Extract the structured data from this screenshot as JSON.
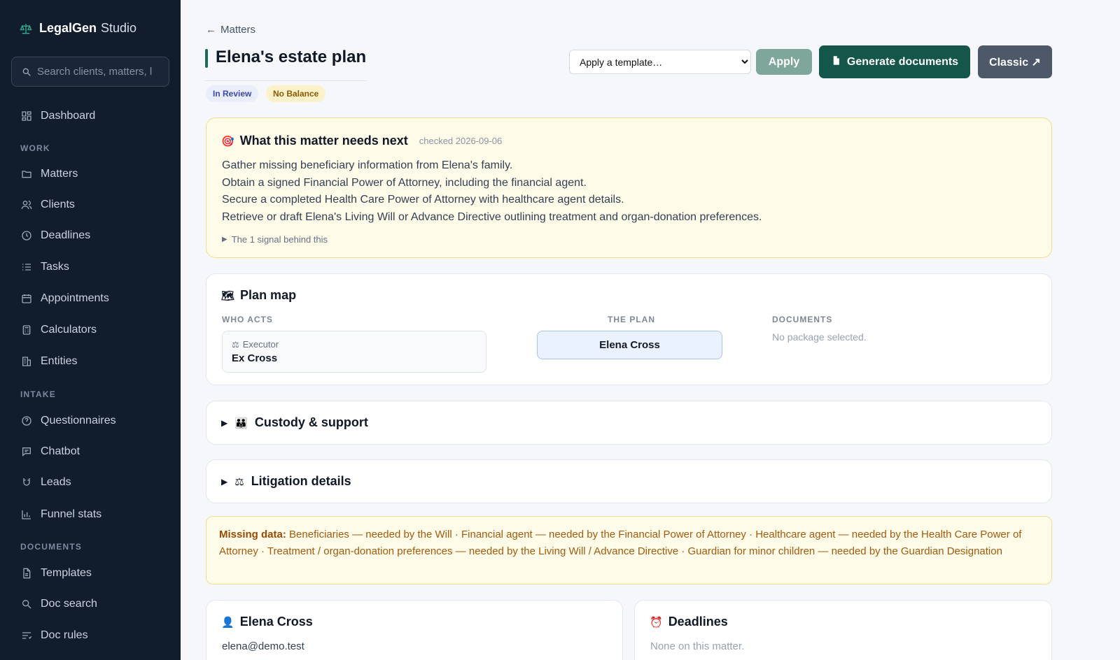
{
  "sidebar": {
    "brand_bold": "LegalGen",
    "brand_light": "Studio",
    "search_placeholder": "Search clients, matters, l",
    "dashboard": "Dashboard",
    "sections": {
      "work": "WORK",
      "intake": "INTAKE",
      "documents": "DOCUMENTS"
    },
    "work_items": [
      "Matters",
      "Clients",
      "Deadlines",
      "Tasks",
      "Appointments",
      "Calculators",
      "Entities"
    ],
    "intake_items": [
      "Questionnaires",
      "Chatbot",
      "Leads",
      "Funnel stats"
    ],
    "document_items": [
      "Templates",
      "Doc search",
      "Doc rules"
    ]
  },
  "header": {
    "back_label": "Matters",
    "title": "Elena's estate plan",
    "badges": {
      "status": "In Review",
      "balance": "No Balance"
    },
    "template_placeholder": "Apply a template…",
    "apply_label": "Apply",
    "generate_label": "Generate documents",
    "classic_label": "Classic ↗"
  },
  "next": {
    "title": "What this matter needs next",
    "checked": "checked 2026-09-06",
    "items": [
      "Gather missing beneficiary information from Elena's family.",
      "Obtain a signed Financial Power of Attorney, including the financial agent.",
      "Secure a completed Health Care Power of Attorney with healthcare agent details.",
      "Retrieve or draft Elena's Living Will or Advance Directive outlining treatment and organ-donation preferences."
    ],
    "signal": "The 1 signal behind this"
  },
  "plan": {
    "title": "Plan map",
    "who_acts": "WHO ACTS",
    "the_plan": "THE PLAN",
    "documents": "DOCUMENTS",
    "actor_role": "Executor",
    "actor_name": "Ex Cross",
    "person": "Elena Cross",
    "no_package": "No package selected."
  },
  "custody": {
    "title": "Custody & support"
  },
  "litigation": {
    "title": "Litigation details"
  },
  "missing": {
    "label": "Missing data:",
    "text": "Beneficiaries — needed by the Will · Financial agent — needed by the Financial Power of Attorney · Healthcare agent — needed by the Health Care Power of Attorney · Treatment / organ-donation preferences — needed by the Living Will / Advance Directive · Guardian for minor children — needed by the Guardian Designation"
  },
  "client": {
    "name": "Elena Cross",
    "email": "elena@demo.test"
  },
  "deadlines": {
    "title": "Deadlines",
    "empty": "None on this matter."
  },
  "colors": {
    "sidebar": "#111c2d",
    "accent": "#14564a",
    "warn_bg": "#fefbe9",
    "warn_text": "#a45a0d"
  }
}
